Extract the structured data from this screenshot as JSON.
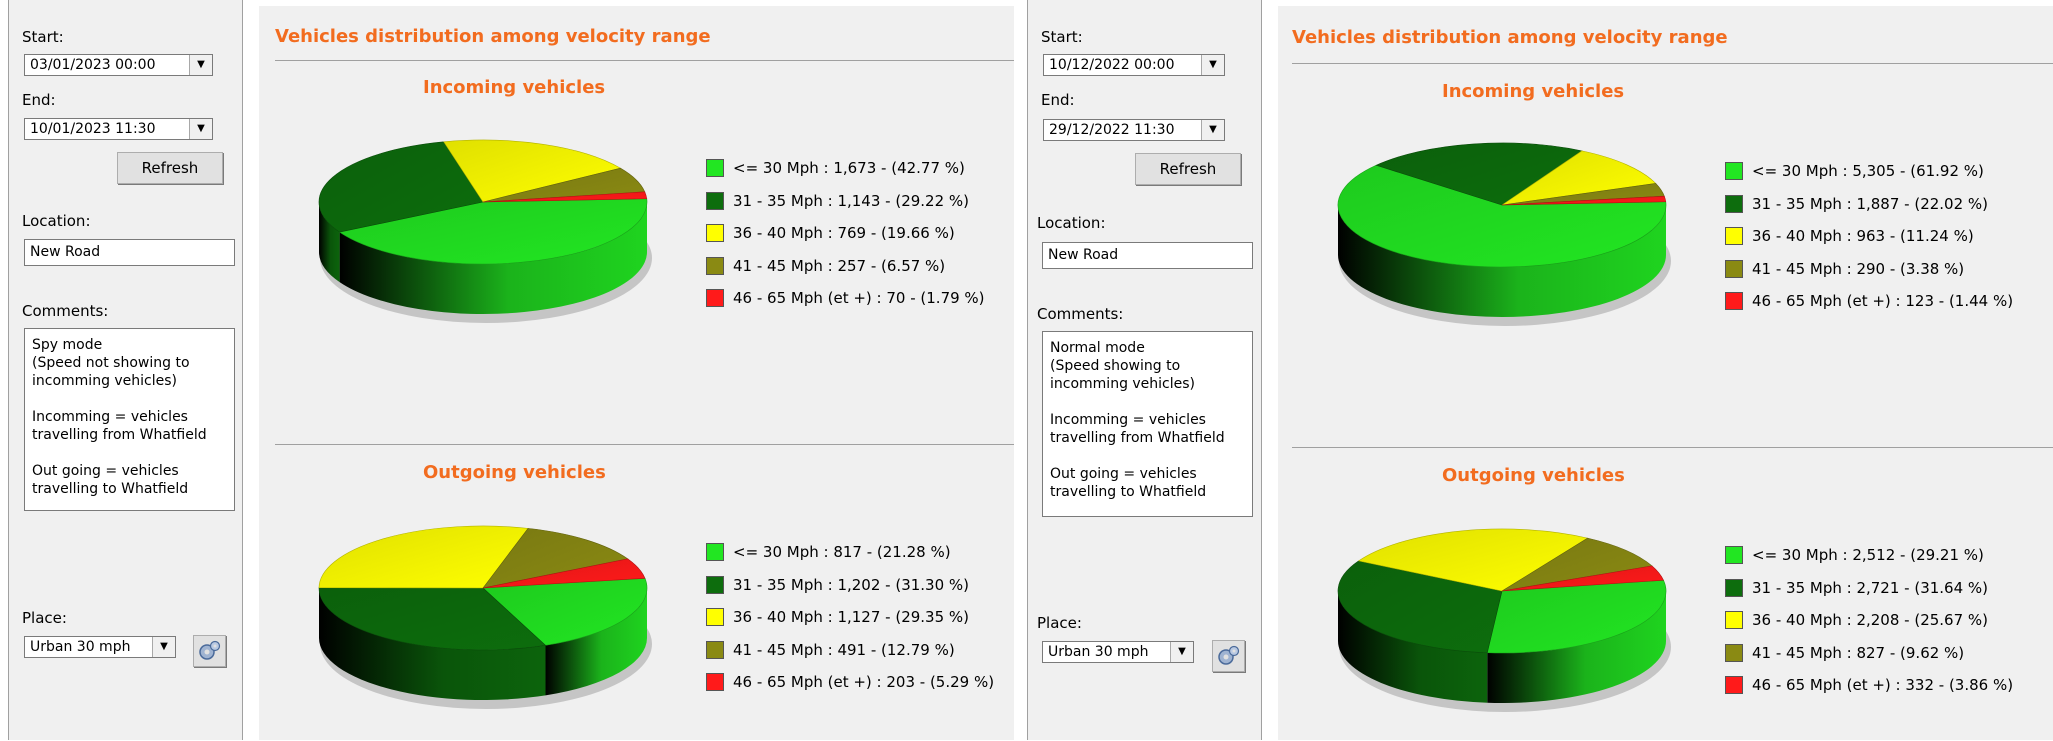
{
  "panels": [
    {
      "sidebar": {
        "start_label": "Start:",
        "start_value": "03/01/2023 00:00",
        "end_label": "End:",
        "end_value": "10/01/2023 11:30",
        "refresh_label": "Refresh",
        "location_label": "Location:",
        "location_value": "New Road",
        "comments_label": "Comments:",
        "comments_value": "Spy mode\n(Speed not showing to\nincomming vehicles)\n\nIncomming = vehicles\ntravelling from Whatfield\n\nOut going = vehicles\ntravelling to Whatfield",
        "place_label": "Place:",
        "place_value": "Urban 30 mph"
      },
      "header": "Vehicles distribution among velocity range"
    },
    {
      "sidebar": {
        "start_label": "Start:",
        "start_value": "10/12/2022 00:00",
        "end_label": "End:",
        "end_value": "29/12/2022 11:30",
        "refresh_label": "Refresh",
        "location_label": "Location:",
        "location_value": "New Road",
        "comments_label": "Comments:",
        "comments_value": "Normal mode\n(Speed showing to\nincomming vehicles)\n\nIncomming = vehicles\ntravelling from Whatfield\n\nOut going = vehicles\ntravelling to Whatfield",
        "place_label": "Place:",
        "place_value": "Urban 30 mph"
      },
      "header": "Vehicles distribution among velocity range"
    }
  ],
  "colors": {
    "lt30": "#22e622",
    "r31_35": "#0d6d0d",
    "r36_40": "#ffff00",
    "r41_45": "#8a8a13",
    "r46_65": "#ff1a1a",
    "accent_orange": "#f26c1f"
  },
  "chart_data": [
    {
      "type": "pie",
      "title": "Incoming vehicles",
      "categories": [
        "<= 30 Mph",
        "31 - 35 Mph",
        "36 - 40 Mph",
        "41 - 45 Mph",
        "46 - 65 Mph (et +)"
      ],
      "values": [
        1673,
        1143,
        769,
        257,
        70
      ],
      "percents": [
        42.77,
        29.22,
        19.66,
        6.57,
        1.79
      ],
      "legend_labels": [
        "<= 30 Mph :  1,673 -  (42.77 %)",
        "31 - 35 Mph :  1,143 -  (29.22 %)",
        "36 - 40 Mph :    769 -  (19.66 %)",
        "41 - 45 Mph :    257 -  (6.57 %)",
        "46 - 65 Mph (et +) :     70 -  (1.79 %)"
      ]
    },
    {
      "type": "pie",
      "title": "Outgoing vehicles",
      "categories": [
        "<= 30 Mph",
        "31 - 35 Mph",
        "36 - 40 Mph",
        "41 - 45 Mph",
        "46 - 65 Mph (et +)"
      ],
      "values": [
        817,
        1202,
        1127,
        491,
        203
      ],
      "percents": [
        21.28,
        31.3,
        29.35,
        12.79,
        5.29
      ],
      "legend_labels": [
        "<= 30 Mph :    817 -  (21.28 %)",
        "31 - 35 Mph :  1,202 -  (31.30 %)",
        "36 - 40 Mph :  1,127 -  (29.35 %)",
        "41 - 45 Mph :    491 -  (12.79 %)",
        "46 - 65 Mph (et +) :   203 -  (5.29 %)"
      ]
    },
    {
      "type": "pie",
      "title": "Incoming vehicles",
      "categories": [
        "<= 30 Mph",
        "31 - 35 Mph",
        "36 - 40 Mph",
        "41 - 45 Mph",
        "46 - 65 Mph (et +)"
      ],
      "values": [
        5305,
        1887,
        963,
        290,
        123
      ],
      "percents": [
        61.92,
        22.02,
        11.24,
        3.38,
        1.44
      ],
      "legend_labels": [
        "<= 30 Mph :  5,305 -  (61.92 %)",
        "31 - 35 Mph :  1,887 -  (22.02 %)",
        "36 - 40 Mph :    963 -  (11.24 %)",
        "41 - 45 Mph :    290 -  (3.38 %)",
        "46 - 65 Mph (et +) :   123 -  (1.44 %)"
      ]
    },
    {
      "type": "pie",
      "title": "Outgoing vehicles",
      "categories": [
        "<= 30 Mph",
        "31 - 35 Mph",
        "36 - 40 Mph",
        "41 - 45 Mph",
        "46 - 65 Mph (et +)"
      ],
      "values": [
        2512,
        2721,
        2208,
        827,
        332
      ],
      "percents": [
        29.21,
        31.64,
        25.67,
        9.62,
        3.86
      ],
      "legend_labels": [
        "<= 30 Mph :  2,512 -  (29.21 %)",
        "31 - 35 Mph :  2,721 -  (31.64 %)",
        "36 - 40 Mph :  2,208 -  (25.67 %)",
        "41 - 45 Mph :    827 -  (9.62 %)",
        "46 - 65 Mph (et +) :   332 -  (3.86 %)"
      ]
    }
  ]
}
